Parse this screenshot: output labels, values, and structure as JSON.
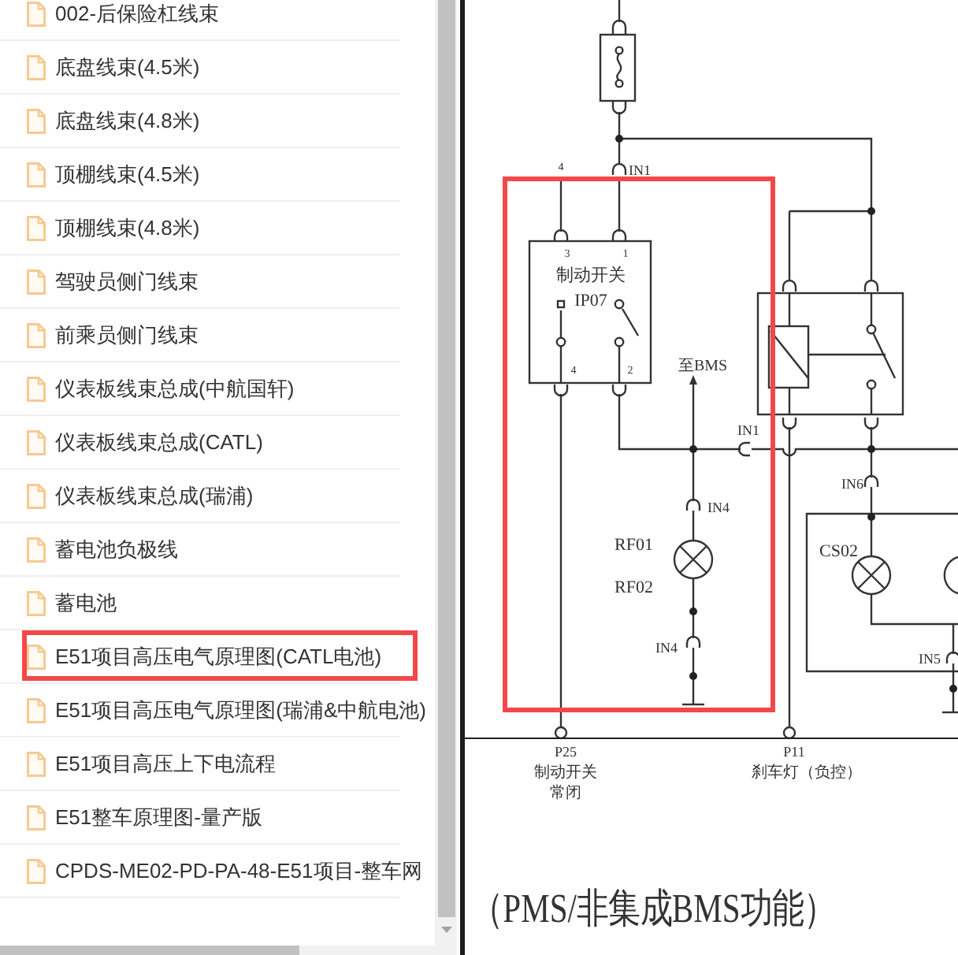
{
  "file_list": {
    "items": [
      {
        "name": "002-后保险杠线束",
        "highlighted": false
      },
      {
        "name": "底盘线束(4.5米)",
        "highlighted": false
      },
      {
        "name": "底盘线束(4.8米)",
        "highlighted": false
      },
      {
        "name": "顶棚线束(4.5米)",
        "highlighted": false
      },
      {
        "name": "顶棚线束(4.8米)",
        "highlighted": false
      },
      {
        "name": "驾驶员侧门线束",
        "highlighted": false
      },
      {
        "name": "前乘员侧门线束",
        "highlighted": false
      },
      {
        "name": "仪表板线束总成(中航国轩)",
        "highlighted": false
      },
      {
        "name": "仪表板线束总成(CATL)",
        "highlighted": false
      },
      {
        "name": "仪表板线束总成(瑞浦)",
        "highlighted": false
      },
      {
        "name": "蓄电池负极线",
        "highlighted": false
      },
      {
        "name": "蓄电池",
        "highlighted": false
      },
      {
        "name": "E51项目高压电气原理图(CATL电池)",
        "highlighted": true
      },
      {
        "name": "E51项目高压电气原理图(瑞浦&中航电池)",
        "highlighted": false
      },
      {
        "name": "E51项目高压上下电流程",
        "highlighted": false
      },
      {
        "name": "E51整车原理图-量产版",
        "highlighted": false
      },
      {
        "name": "CPDS-ME02-PD-PA-48-E51项目-整车网",
        "highlighted": false
      }
    ]
  },
  "document": {
    "schematic": {
      "connectors": [
        {
          "label": "IN1"
        },
        {
          "label": "IN1"
        },
        {
          "label": "IN4"
        },
        {
          "label": "IN4"
        },
        {
          "label": "IN6"
        },
        {
          "label": "IN5"
        }
      ],
      "feed_pin": "4",
      "brake_switch": {
        "name": "制动开关",
        "code": "IP07",
        "pins": [
          "3",
          "1",
          "4",
          "2"
        ]
      },
      "bms_arrow": "至BMS",
      "lamp_codes": [
        "RF01",
        "RF02"
      ],
      "module_code": "CS02",
      "terminals": [
        {
          "code": "P25",
          "lines": [
            "制动开关",
            "常闭"
          ]
        },
        {
          "code": "P11",
          "lines": [
            "刹车灯（负控）"
          ]
        }
      ],
      "highlight_box": true
    },
    "caption": "（PMS/非集成BMS功能）"
  }
}
